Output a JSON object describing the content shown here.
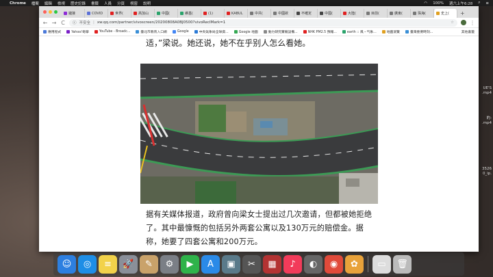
{
  "menubar": {
    "app": "Chrome",
    "items": [
      "檔案",
      "編輯",
      "檢視",
      "歷史記錄",
      "書籤",
      "人員",
      "分頁",
      "視窗",
      "說明"
    ],
    "right": [
      "100%",
      "週六上午6:28"
    ]
  },
  "tabs": [
    {
      "label": "鏈接",
      "color": "#8e2bd6"
    },
    {
      "label": "COVID",
      "color": "#5a6fd6"
    },
    {
      "label": "世界(",
      "color": "#e02020"
    },
    {
      "label": "高加山",
      "color": "#e02020"
    },
    {
      "label": "中國(",
      "color": "#2aa36b"
    },
    {
      "label": "維基(",
      "color": "#2aa36b"
    },
    {
      "label": "(1)",
      "color": "#e02020"
    },
    {
      "label": "KABUL",
      "color": "#e02020"
    },
    {
      "label": "中共(",
      "color": "#777777"
    },
    {
      "label": "中國欲",
      "color": "#777777"
    },
    {
      "label": "不確定",
      "color": "#444444"
    },
    {
      "label": "中國(",
      "color": "#444444"
    },
    {
      "label": "大陸(",
      "color": "#e02020"
    },
    {
      "label": "目前(",
      "color": "#777777"
    },
    {
      "label": "廣東(",
      "color": "#777777"
    },
    {
      "label": "珠海(",
      "color": "#777777"
    },
    {
      "label": "史上(",
      "color": "#e0a020",
      "active": true
    }
  ],
  "toolbar": {
    "back": "←",
    "forward": "→",
    "reload": "C",
    "security_label": "不安全",
    "url": "xw.qq.com/partner/vivoscreen/20200808A0BJ0500?vivoRecIMark=1"
  },
  "bookmarks": [
    {
      "label": "應用程式",
      "color": "#4a79d9"
    },
    {
      "label": "Yahoo!奇摩",
      "color": "#7a1fc6"
    },
    {
      "label": "YouTube - Broadc...",
      "color": "#e02020"
    },
    {
      "label": "臺北市教育入口網",
      "color": "#3a8fd6"
    },
    {
      "label": "Google",
      "color": "#4285f4"
    },
    {
      "label": "中央氣象局全球資...",
      "color": "#2a7ad6"
    },
    {
      "label": "Google 地圖",
      "color": "#34a853"
    },
    {
      "label": "動力研究實驗設備...",
      "color": "#888888"
    },
    {
      "label": "NHK PM2.5 預報...",
      "color": "#e02020"
    },
    {
      "label": "earth :: 風・气象...",
      "color": "#2aa36b"
    },
    {
      "label": "地圖瀏覽",
      "color": "#e0a020"
    },
    {
      "label": "臺灣重要時刻...",
      "color": "#3a8fd6"
    }
  ],
  "bookmarks_right": "其他書籤",
  "article": {
    "top_text": "适，”梁说。她还说，她不在乎别人怎么看她。",
    "bottom_text": "据有关媒体报道，政府曾向梁女士提出过几次邀请，但都被她拒绝了。其中最慷慨的包括另外两套公寓以及130万元的赔偿金。据称，她要了四套公寓和200万元。",
    "photo_alt": "aerial view of house surrounded by elevated road"
  },
  "desktop_files": [
    "UE'S",
    ".mp4",
    "的-",
    ".mp4",
    "3526",
    "0_ip."
  ],
  "dock": [
    {
      "name": "finder",
      "glyph": "☺",
      "color": "#2d7fe0"
    },
    {
      "name": "safari",
      "glyph": "◎",
      "color": "#1e8ee6"
    },
    {
      "name": "notes",
      "glyph": "≡",
      "color": "#f2d24a"
    },
    {
      "name": "launchpad",
      "glyph": "🚀",
      "color": "#8a8f99"
    },
    {
      "name": "textedit",
      "glyph": "✎",
      "color": "#c9a26a"
    },
    {
      "name": "system-preferences",
      "glyph": "⚙",
      "color": "#7b7f86"
    },
    {
      "name": "facetime",
      "glyph": "▶",
      "color": "#2fb34a"
    },
    {
      "name": "app-store",
      "glyph": "A",
      "color": "#2a8ae8"
    },
    {
      "name": "preview",
      "glyph": "▣",
      "color": "#5a7a8a"
    },
    {
      "name": "final-cut-pro",
      "glyph": "✂",
      "color": "#555555"
    },
    {
      "name": "photo-booth",
      "glyph": "▦",
      "color": "#b33333"
    },
    {
      "name": "music",
      "glyph": "♪",
      "color": "#f23b5a"
    },
    {
      "name": "disk-utility",
      "glyph": "◐",
      "color": "#666666"
    },
    {
      "name": "chrome",
      "glyph": "◉",
      "color": "#e04a3a"
    },
    {
      "name": "photos",
      "glyph": "✿",
      "color": "#e8a23a"
    },
    {
      "name": "screen-window",
      "glyph": "▭",
      "color": "#dddddd"
    },
    {
      "name": "trash",
      "glyph": "🗑",
      "color": "#bbbbbb"
    }
  ]
}
